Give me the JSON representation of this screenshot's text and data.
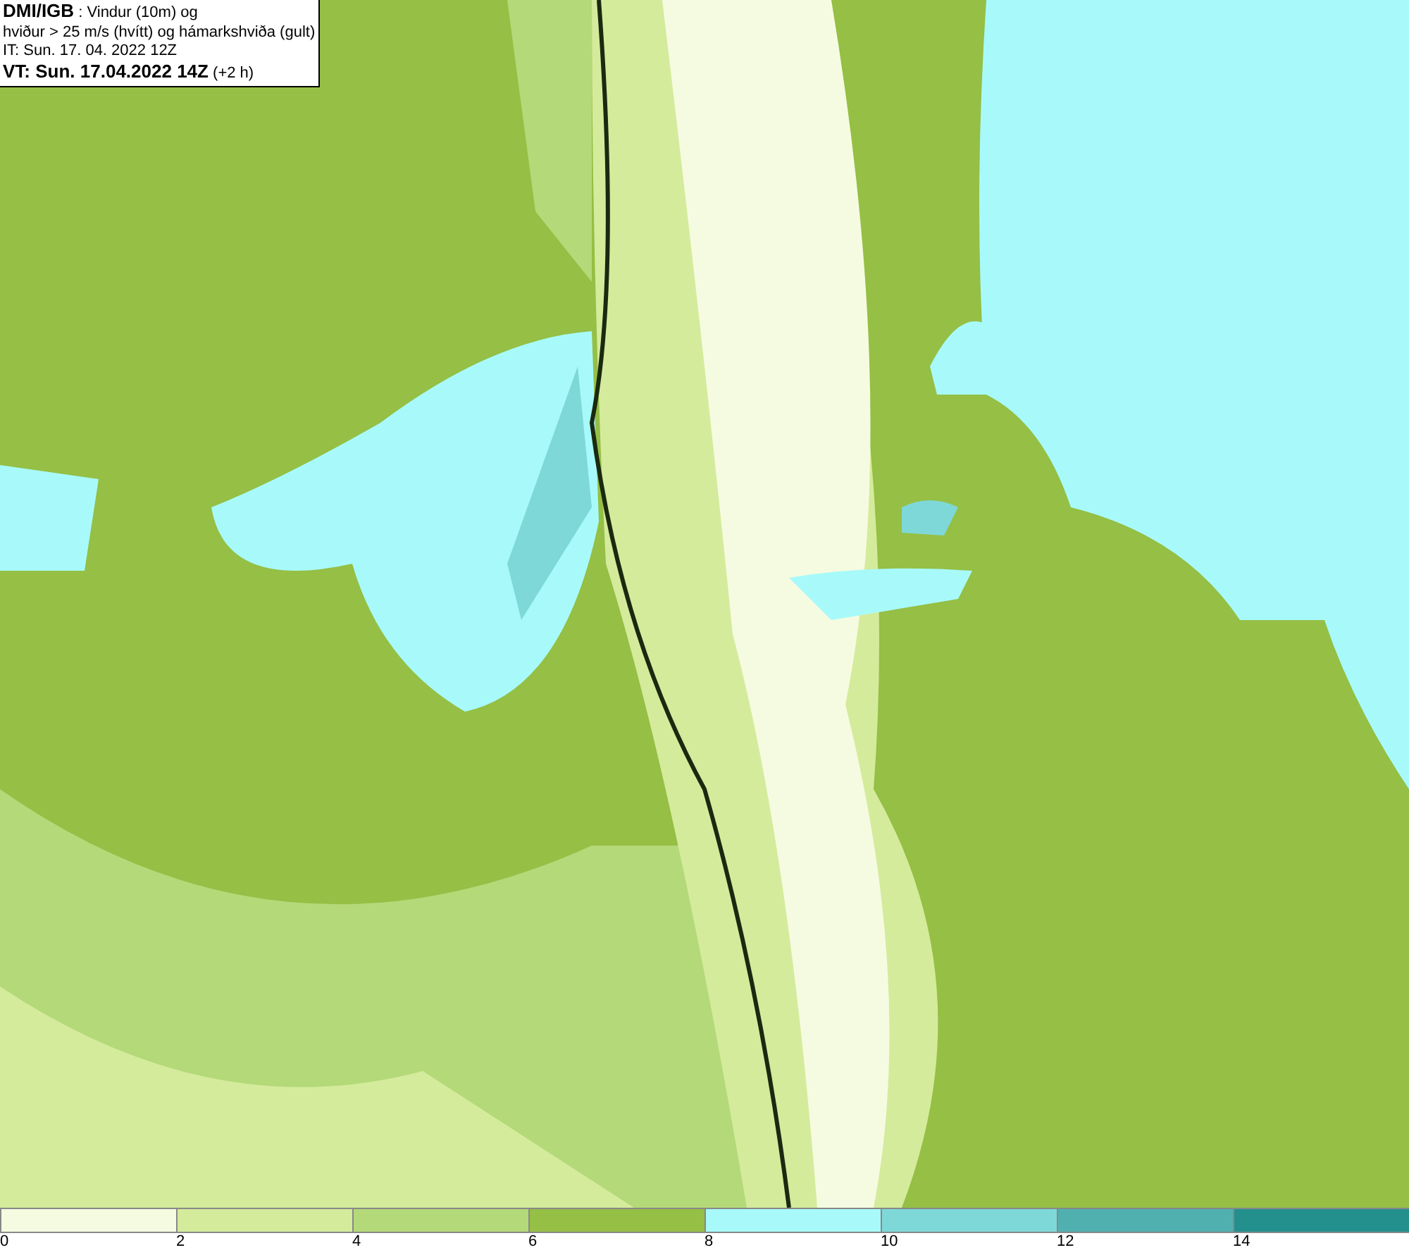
{
  "header": {
    "lines": [
      "**DMI/IGB** : Vindur (10m) og",
      "hviður > 25 m/s (hvítt) og hámarkshviða (gult)",
      "IT: Sun. 17. 04. 2022 12Z",
      "**VT: Sun. 17.04.2022 14Z** (+2 h)"
    ]
  },
  "legend": {
    "bins": [
      {
        "color": "#f5fbe0",
        "label": "0"
      },
      {
        "color": "#d4eb9c",
        "label": "2"
      },
      {
        "color": "#b4d978",
        "label": "4"
      },
      {
        "color": "#95bf45",
        "label": "6"
      },
      {
        "color": "#a8fafa",
        "label": "8"
      },
      {
        "color": "#7fd8d8",
        "label": "10"
      },
      {
        "color": "#50b0b0",
        "label": "12"
      },
      {
        "color": "#24908e",
        "label": "14"
      }
    ]
  }
}
